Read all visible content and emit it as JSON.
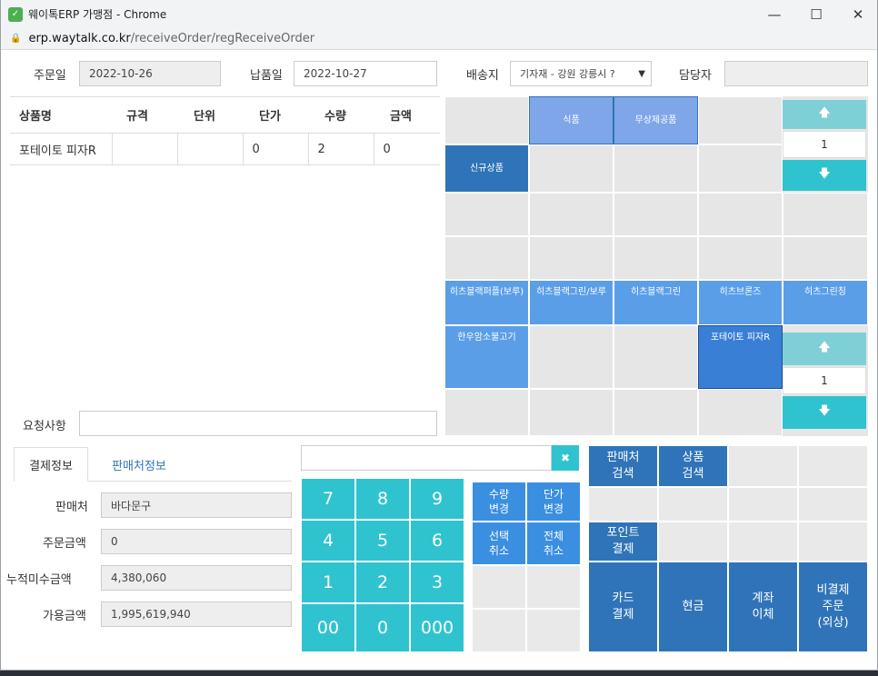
{
  "window": {
    "title": "웨이톡ERP 가맹점 - Chrome",
    "minimize": "—",
    "maximize": "☐",
    "close": "✕"
  },
  "url": {
    "host": "erp.waytalk.co.kr",
    "path": "/receiveOrder/regReceiveOrder"
  },
  "header": {
    "order_date_label": "주문일",
    "order_date": "2022-10-26",
    "delivery_date_label": "납품일",
    "delivery_date": "2022-10-27",
    "destination_label": "배송지",
    "destination": "기자재 - 강원 강릉시 ?",
    "manager_label": "담당자",
    "manager": ""
  },
  "table": {
    "headers": [
      "상품명",
      "규격",
      "단위",
      "단가",
      "수량",
      "금액"
    ],
    "rows": [
      [
        "포테이토 피자R",
        "",
        "",
        "0",
        "2",
        "0"
      ]
    ]
  },
  "category_grid": {
    "food": "식품",
    "free_supply": "무상제공품",
    "new_product": "신규상품",
    "counter_top": "1"
  },
  "product_grid": {
    "items": [
      "히츠블랙퍼플(보루)",
      "히츠블랙그린/보루",
      "히츠블랙그린",
      "히츠브론즈",
      "히츠그린칭",
      "한우암소불고기",
      "포테이토 피자R"
    ],
    "counter_bottom": "1"
  },
  "request": {
    "label": "요청사항",
    "value": ""
  },
  "tabs": {
    "payment": "결제정보",
    "seller": "판매처정보"
  },
  "payment_info": {
    "seller_label": "판매처",
    "seller": "바다문구",
    "order_amount_label": "주문금액",
    "order_amount": "0",
    "unpaid_label": "누적미수금액",
    "unpaid": "4,380,060",
    "available_label": "가용금액",
    "available": "1,995,619,940"
  },
  "keypad": {
    "input": "",
    "clear": "✖",
    "keys": [
      "7",
      "8",
      "9",
      "4",
      "5",
      "6",
      "1",
      "2",
      "3",
      "00",
      "0",
      "000"
    ],
    "qty_change": "수량\n변경",
    "price_change": "단가\n변경",
    "select_cancel": "선택\n취소",
    "all_cancel": "전체\n취소"
  },
  "actions": {
    "seller_search": "판매처\n검색",
    "product_search": "상품\n검색",
    "point_pay": "포인트\n결제",
    "card_pay": "카드\n결제",
    "cash": "현금",
    "transfer": "계좌\n이체",
    "non_pay": "비결제\n주문\n(외상)"
  },
  "colors": {
    "teal": "#2fc3cf",
    "blue": "#4a90e2",
    "dark_blue": "#2f74b8"
  }
}
